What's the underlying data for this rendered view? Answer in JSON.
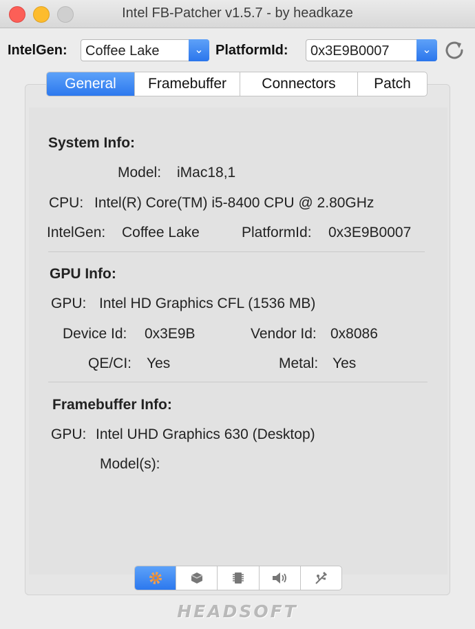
{
  "window": {
    "title": "Intel FB-Patcher v1.5.7 - by headkaze"
  },
  "toolbar": {
    "intelgen_label": "IntelGen:",
    "intelgen_value": "Coffee Lake",
    "platformid_label": "PlatformId:",
    "platformid_value": "0x3E9B0007",
    "refresh_icon": "refresh-icon"
  },
  "tabs": [
    {
      "label": "General",
      "active": true
    },
    {
      "label": "Framebuffer",
      "active": false
    },
    {
      "label": "Connectors",
      "active": false
    },
    {
      "label": "Patch",
      "active": false
    }
  ],
  "system_info": {
    "heading": "System Info:",
    "model_label": "Model:",
    "model_value": "iMac18,1",
    "cpu_label": "CPU:",
    "cpu_value": "Intel(R) Core(TM) i5-8400 CPU @ 2.80GHz",
    "intelgen_label": "IntelGen:",
    "intelgen_value": "Coffee Lake",
    "platformid_label": "PlatformId:",
    "platformid_value": "0x3E9B0007"
  },
  "gpu_info": {
    "heading": "GPU Info:",
    "gpu_label": "GPU:",
    "gpu_value": "Intel HD Graphics CFL (1536 MB)",
    "device_label": "Device Id:",
    "device_value": "0x3E9B",
    "vendor_label": "Vendor Id:",
    "vendor_value": "0x8086",
    "qeci_label": "QE/CI:",
    "qeci_value": "Yes",
    "metal_label": "Metal:",
    "metal_value": "Yes"
  },
  "framebuffer_info": {
    "heading": "Framebuffer Info:",
    "gpu_label": "GPU:",
    "gpu_value": "Intel UHD Graphics 630 (Desktop)",
    "models_label": "Model(s):",
    "models_value": ""
  },
  "bottom_segments": [
    {
      "icon": "gear-icon",
      "active": true
    },
    {
      "icon": "gpu-icon",
      "active": false
    },
    {
      "icon": "chip-icon",
      "active": false
    },
    {
      "icon": "speaker-icon",
      "active": false
    },
    {
      "icon": "usb-icon",
      "active": false
    }
  ],
  "logo": {
    "text": "HEADSOFT"
  },
  "colors": {
    "accent": "#2c78ee",
    "close": "#fc5f57",
    "minimize": "#fdbc2e"
  }
}
